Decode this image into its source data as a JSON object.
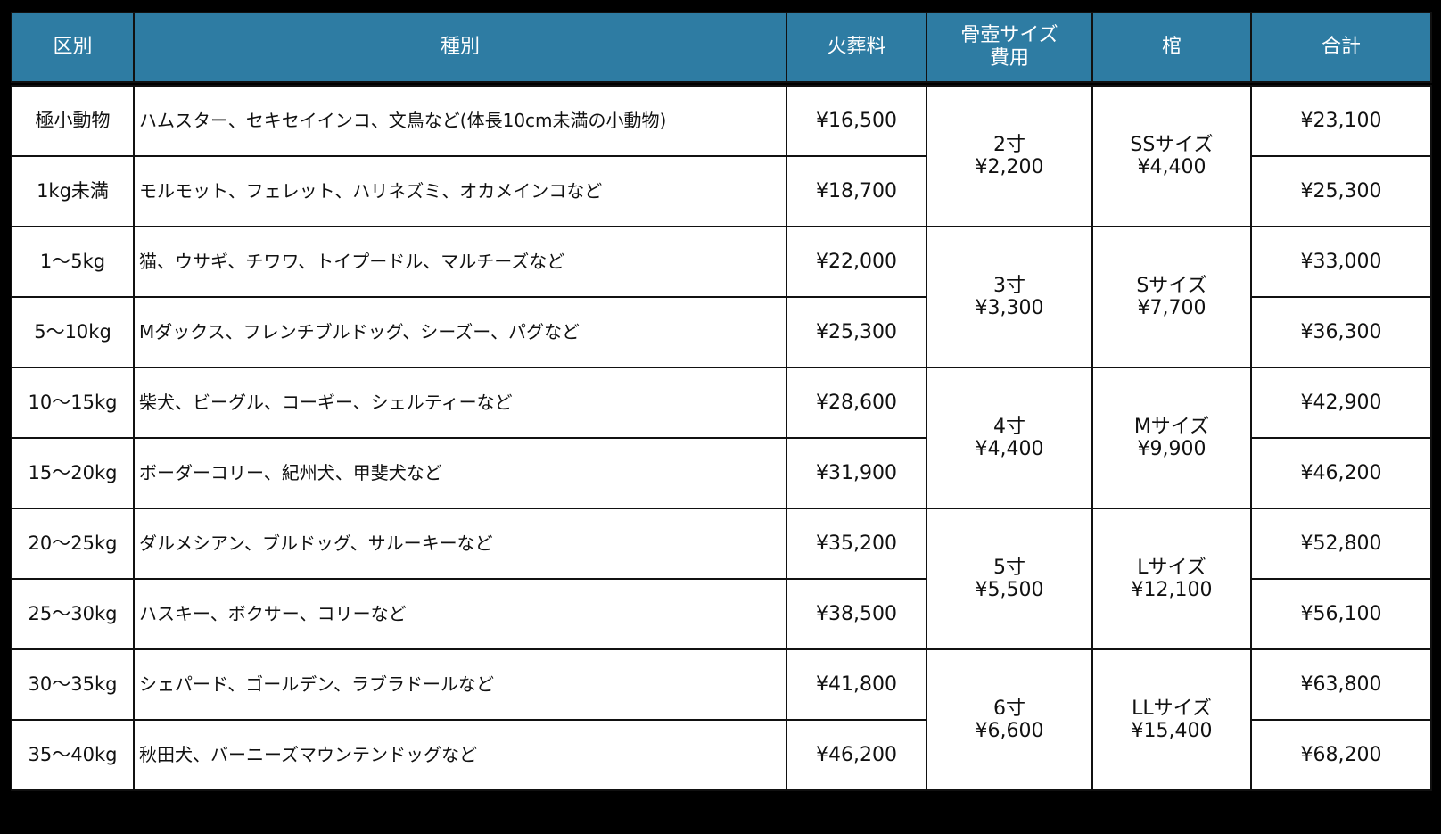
{
  "headers": [
    "区別",
    "種別",
    "火葬料",
    "骨壺サイズ費用",
    "棺",
    "合計"
  ],
  "header_urn_lines": [
    "骨壺サイズ",
    "費用"
  ],
  "rows": [
    {
      "class": "極小動物",
      "kind": "ハムスター、セキセイインコ、文鳥など(体長10cm未満の小動物)",
      "cremation": "¥16,500",
      "total": "¥23,100"
    },
    {
      "class": "1kg未満",
      "kind": "モルモット、フェレット、ハリネズミ、オカメインコなど",
      "cremation": "¥18,700",
      "total": "¥25,300"
    },
    {
      "class": "1～5kg",
      "kind": "猫、ウサギ、チワワ、トイプードル、マルチーズなど",
      "cremation": "¥22,000",
      "total": "¥33,000"
    },
    {
      "class": "5～10kg",
      "kind": "Mダックス、フレンチブルドッグ、シーズー、パグなど",
      "cremation": "¥25,300",
      "total": "¥36,300"
    },
    {
      "class": "10～15kg",
      "kind": "柴犬、ビーグル、コーギー、シェルティーなど",
      "cremation": "¥28,600",
      "total": "¥42,900"
    },
    {
      "class": "15～20kg",
      "kind": "ボーダーコリー、紀州犬、甲斐犬など",
      "cremation": "¥31,900",
      "total": "¥46,200"
    },
    {
      "class": "20～25kg",
      "kind": "ダルメシアン、ブルドッグ、サルーキーなど",
      "cremation": "¥35,200",
      "total": "¥52,800"
    },
    {
      "class": "25～30kg",
      "kind": "ハスキー、ボクサー、コリーなど",
      "cremation": "¥38,500",
      "total": "¥56,100"
    },
    {
      "class": "30～35kg",
      "kind": "シェパード、ゴールデン、ラブラドールなど",
      "cremation": "¥41,800",
      "total": "¥63,800"
    },
    {
      "class": "35～40kg",
      "kind": "秋田犬、バーニーズマウンテンドッグなど",
      "cremation": "¥46,200",
      "total": "¥68,200"
    }
  ],
  "groups": [
    {
      "urn_size": "2寸",
      "urn_price": "¥2,200",
      "coffin_size": "SSサイズ",
      "coffin_price": "¥4,400"
    },
    {
      "urn_size": "3寸",
      "urn_price": "¥3,300",
      "coffin_size": "Sサイズ",
      "coffin_price": "¥7,700"
    },
    {
      "urn_size": "4寸",
      "urn_price": "¥4,400",
      "coffin_size": "Mサイズ",
      "coffin_price": "¥9,900"
    },
    {
      "urn_size": "5寸",
      "urn_price": "¥5,500",
      "coffin_size": "Lサイズ",
      "coffin_price": "¥12,100"
    },
    {
      "urn_size": "6寸",
      "urn_price": "¥6,600",
      "coffin_size": "LLサイズ",
      "coffin_price": "¥15,400"
    }
  ]
}
